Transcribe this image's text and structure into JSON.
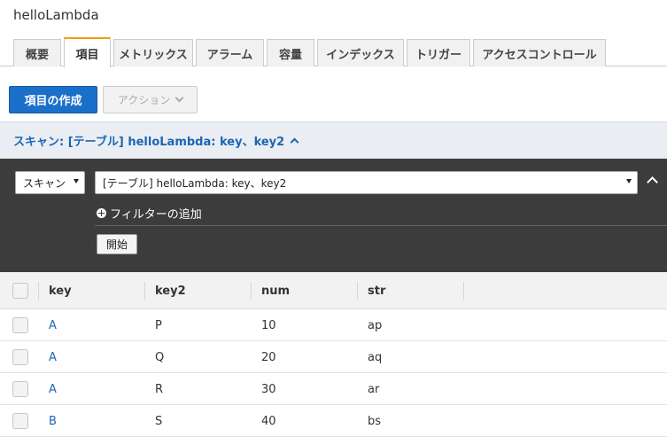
{
  "app": {
    "title": "helloLambda"
  },
  "tabs": [
    {
      "label": "概要",
      "active": false
    },
    {
      "label": "項目",
      "active": true
    },
    {
      "label": "メトリックス",
      "active": false
    },
    {
      "label": "アラーム",
      "active": false
    },
    {
      "label": "容量",
      "active": false
    },
    {
      "label": "インデックス",
      "active": false
    },
    {
      "label": "トリガー",
      "active": false
    },
    {
      "label": "アクセスコントロール",
      "active": false
    }
  ],
  "toolbar": {
    "create_label": "項目の作成",
    "actions_label": "アクション"
  },
  "scan": {
    "header": "スキャン: [テーブル] helloLambda: key、key2",
    "mode_value": "スキャン",
    "target_value": "[テーブル] helloLambda: key、key2",
    "add_filter_label": "フィルターの追加",
    "start_label": "開始"
  },
  "table": {
    "columns": [
      "key",
      "key2",
      "num",
      "str"
    ],
    "rows": [
      [
        "A",
        "P",
        "10",
        "ap"
      ],
      [
        "A",
        "Q",
        "20",
        "aq"
      ],
      [
        "A",
        "R",
        "30",
        "ar"
      ],
      [
        "B",
        "S",
        "40",
        "bs"
      ]
    ]
  },
  "colors": {
    "primary": "#1a6fc9",
    "accent_tab": "#f39c12",
    "link": "#1b66b3",
    "panel": "#3c3c3c"
  }
}
